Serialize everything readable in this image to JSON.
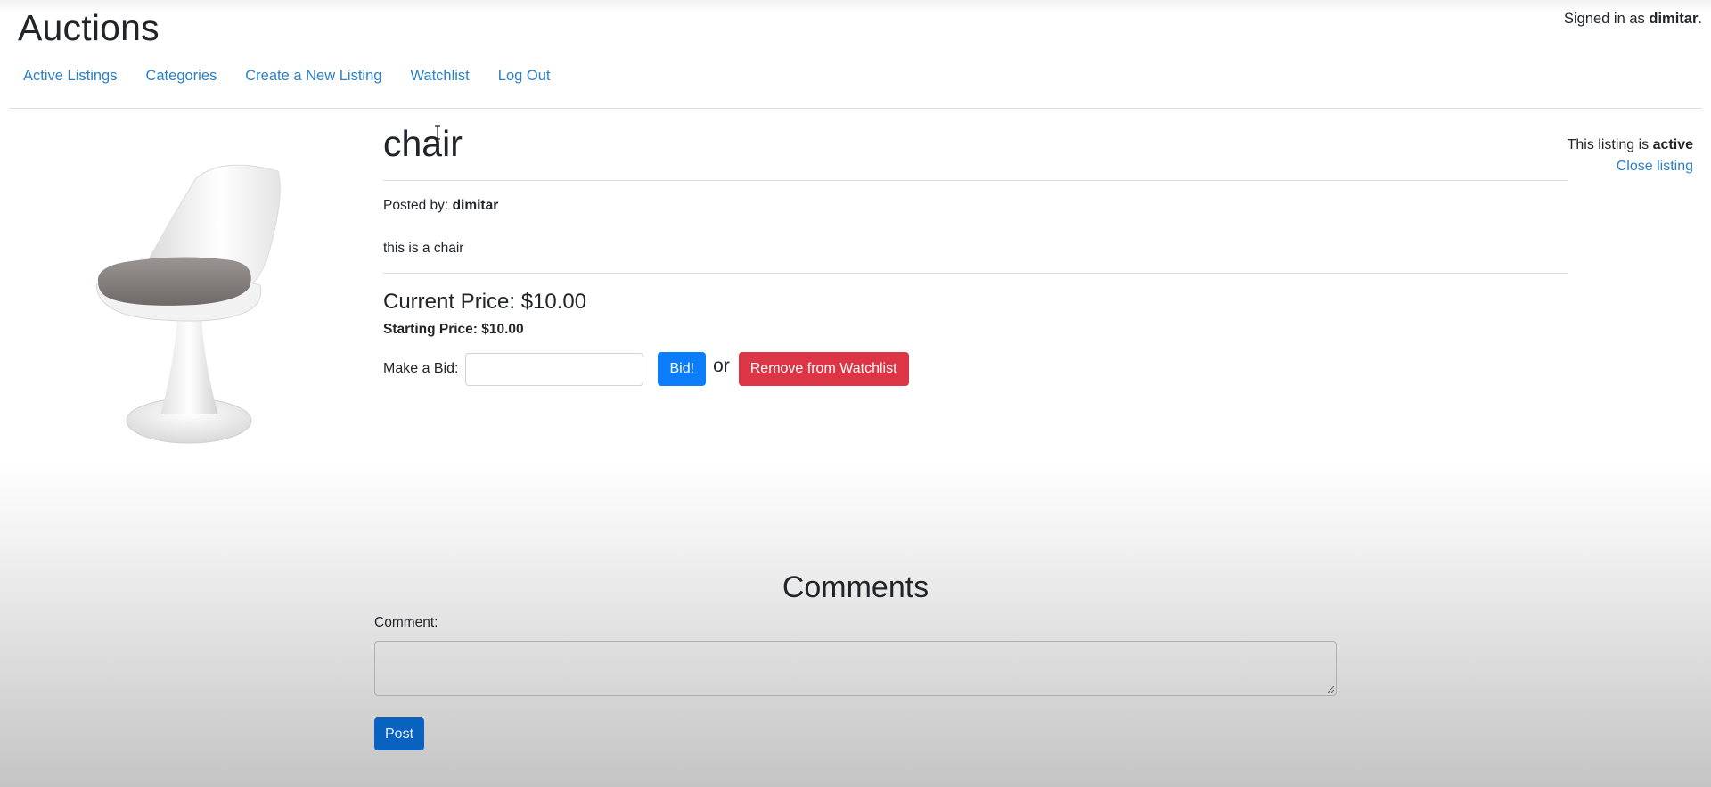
{
  "header": {
    "site_title": "Auctions",
    "signed_in_prefix": "Signed in as",
    "username": "dimitar",
    "signed_in_suffix": "."
  },
  "nav": {
    "items": [
      {
        "label": "Active Listings"
      },
      {
        "label": "Categories"
      },
      {
        "label": "Create a New Listing"
      },
      {
        "label": "Watchlist"
      },
      {
        "label": "Log Out"
      }
    ]
  },
  "listing": {
    "title": "chair",
    "status_prefix": "This listing is",
    "status": "active",
    "close_label": "Close listing",
    "posted_by_label": "Posted by:",
    "posted_by": "dimitar",
    "description": "this is a chair",
    "current_price": "Current Price: $10.00",
    "starting_price": "Starting Price: $10.00",
    "image_icon": "chair-image"
  },
  "bid": {
    "label": "Make a Bid:",
    "input_value": "",
    "button_label": "Bid!",
    "or_text": "or",
    "watchlist_button_label": "Remove from Watchlist"
  },
  "comments": {
    "heading": "Comments",
    "field_label": "Comment:",
    "field_value": "",
    "post_label": "Post"
  },
  "colors": {
    "link": "#2c80c6",
    "primary_button": "#0b7dfa",
    "danger_button": "#dc3545",
    "post_button": "#0a62c0"
  }
}
